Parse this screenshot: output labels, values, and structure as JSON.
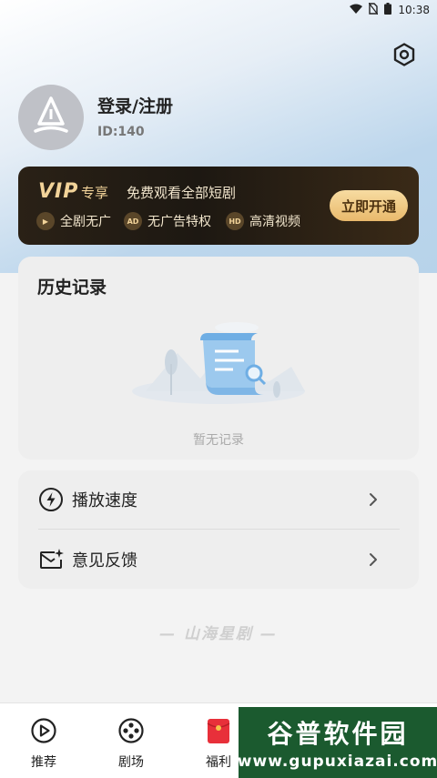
{
  "status_bar": {
    "time": "10:38"
  },
  "profile": {
    "name": "登录/注册",
    "id": "ID:140"
  },
  "vip": {
    "logo": "VIP",
    "exclusive": "专享",
    "description": "免费观看全部短剧",
    "features": [
      {
        "icon_text": "▶",
        "label": "全剧无广"
      },
      {
        "icon_text": "AD",
        "label": "无广告特权"
      },
      {
        "icon_text": "HD",
        "label": "高清视频"
      }
    ],
    "button": "立即开通"
  },
  "history": {
    "title": "历史记录",
    "empty": "暂无记录"
  },
  "menu": [
    {
      "label": "播放速度",
      "icon": "lightning-icon"
    },
    {
      "label": "意见反馈",
      "icon": "feedback-mail-icon"
    }
  ],
  "brand_mark": "— 山海星剧 —",
  "tabs": [
    {
      "label": "推荐",
      "icon": "play-circle-icon"
    },
    {
      "label": "剧场",
      "icon": "film-reel-icon"
    },
    {
      "label": "福利",
      "icon": "red-envelope-icon"
    }
  ],
  "watermark": {
    "title": "谷普软件园",
    "url": "www.gupuxiazai.com"
  },
  "colors": {
    "vip_gold": "#f2d399",
    "vip_bg": "#1d1812",
    "accent_red": "#e8303a"
  }
}
